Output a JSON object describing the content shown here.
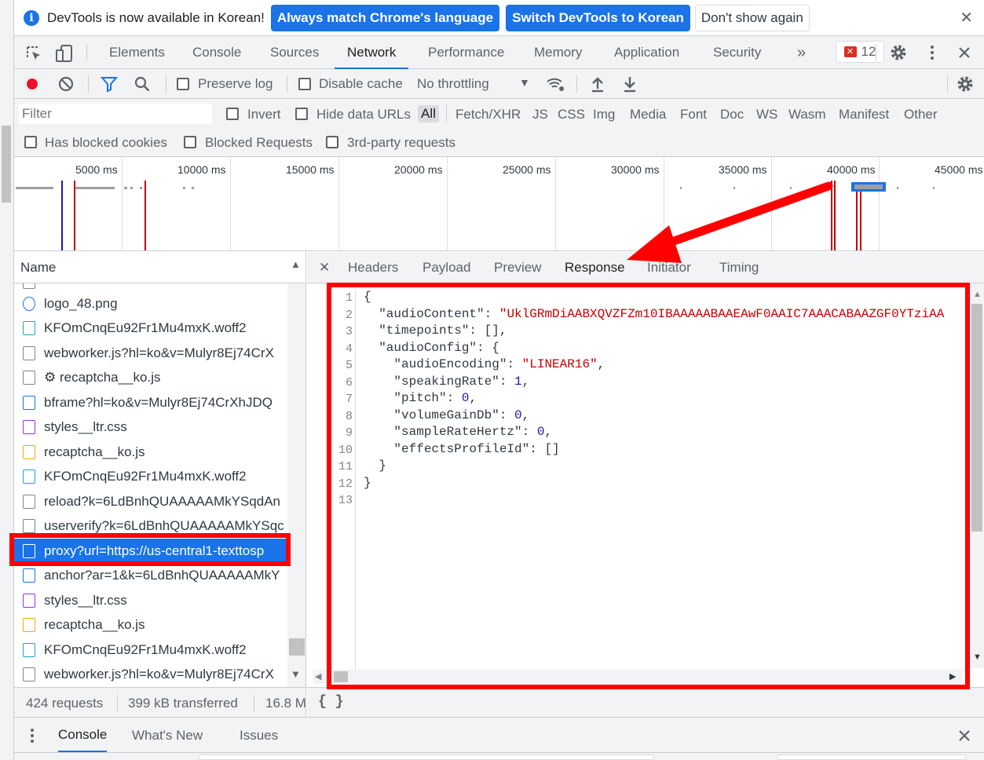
{
  "infobar": {
    "message": "DevTools is now available in Korean!",
    "btn_match": "Always match Chrome's language",
    "btn_switch": "Switch DevTools to Korean",
    "btn_dismiss": "Don't show again",
    "close": "✕"
  },
  "main_tabs": [
    "Elements",
    "Console",
    "Sources",
    "Network",
    "Performance",
    "Memory",
    "Application",
    "Security"
  ],
  "more_tabs": "»",
  "error_count": "12",
  "toolbar": {
    "preserve_log": "Preserve log",
    "disable_cache": "Disable cache",
    "throttling": "No throttling"
  },
  "filter": {
    "placeholder": "Filter",
    "invert": "Invert",
    "hide_data_urls": "Hide data URLs",
    "types": [
      "All",
      "Fetch/XHR",
      "JS",
      "CSS",
      "Img",
      "Media",
      "Font",
      "Doc",
      "WS",
      "Wasm",
      "Manifest",
      "Other"
    ],
    "has_blocked_cookies": "Has blocked cookies",
    "blocked_requests": "Blocked Requests",
    "third_party": "3rd-party requests"
  },
  "overview": {
    "ticks": [
      "5000 ms",
      "10000 ms",
      "15000 ms",
      "20000 ms",
      "25000 ms",
      "30000 ms",
      "35000 ms",
      "40000 ms",
      "45000 ms"
    ]
  },
  "requests": {
    "header": "Name",
    "rows": [
      {
        "name": "logo_48.png",
        "type": "img"
      },
      {
        "name": "KFOmCnqEu92Fr1Mu4mxK.woff2",
        "type": "font"
      },
      {
        "name": "webworker.js?hl=ko&v=Mulyr8Ej74CrX",
        "type": "doc"
      },
      {
        "name": "⚙ recaptcha__ko.js",
        "type": "doc"
      },
      {
        "name": "bframe?hl=ko&v=Mulyr8Ej74CrXhJDQ",
        "type": "html"
      },
      {
        "name": "styles__ltr.css",
        "type": "css"
      },
      {
        "name": "recaptcha__ko.js",
        "type": "js"
      },
      {
        "name": "KFOmCnqEu92Fr1Mu4mxK.woff2",
        "type": "font"
      },
      {
        "name": "reload?k=6LdBnhQUAAAAAMkYSqdAn",
        "type": "doc"
      },
      {
        "name": "userverify?k=6LdBnhQUAAAAAMkYSqc",
        "type": "doc"
      },
      {
        "name": "proxy?url=https://us-central1-texttosp",
        "type": "doc",
        "selected": true
      },
      {
        "name": "anchor?ar=1&k=6LdBnhQUAAAAAMkY",
        "type": "html"
      },
      {
        "name": "styles__ltr.css",
        "type": "css"
      },
      {
        "name": "recaptcha__ko.js",
        "type": "js"
      },
      {
        "name": "KFOmCnqEu92Fr1Mu4mxK.woff2",
        "type": "font"
      },
      {
        "name": "webworker.js?hl=ko&v=Mulyr8Ej74CrX",
        "type": "doc"
      }
    ]
  },
  "status": {
    "requests": "424 requests",
    "transferred": "399 kB transferred",
    "resources": "16.8 M"
  },
  "detail_tabs": [
    "Headers",
    "Payload",
    "Preview",
    "Response",
    "Initiator",
    "Timing"
  ],
  "response": {
    "line_numbers": [
      "1",
      "2",
      "3",
      "4",
      "5",
      "6",
      "7",
      "8",
      "9",
      "10",
      "11",
      "12",
      "13"
    ],
    "audio_content": "UklGRmDiAABXQVZFZm10IBAAAAABAAEAwF0AAIC7AAACABAAZGF0YTziAA",
    "audio_encoding": "LINEAR16",
    "speaking_rate": "1",
    "pitch": "0",
    "volume_gain_db": "0",
    "sample_rate_hertz": "0"
  },
  "pretty_print": "{ }",
  "drawer_tabs": [
    "Console",
    "What's New",
    "Issues"
  ]
}
